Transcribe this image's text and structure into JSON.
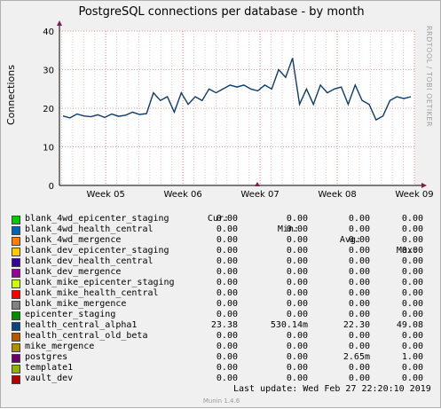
{
  "chart_data": {
    "type": "line",
    "title": "PostgreSQL connections per database - by month",
    "ylabel": "Connections",
    "ylim": [
      0,
      40
    ],
    "yticks": [
      0,
      10,
      20,
      30,
      40
    ],
    "xticks": [
      "Week 05",
      "Week 06",
      "Week 07",
      "Week 08",
      "Week 09"
    ],
    "grid": true,
    "series": [
      {
        "name": "health_central_alpha1",
        "color": "#0a3d6b",
        "x": [
          0,
          2,
          4,
          6,
          8,
          10,
          12,
          14,
          16,
          18,
          20,
          22,
          24,
          26,
          28,
          30,
          32,
          34,
          36,
          38,
          40,
          42,
          44,
          46,
          48,
          50,
          52,
          54,
          56,
          58,
          60,
          62,
          64,
          66,
          68,
          70,
          72,
          74,
          76,
          78,
          80,
          82,
          84,
          86,
          88,
          90,
          92,
          94,
          96,
          98,
          100
        ],
        "values": [
          18,
          17.5,
          18.5,
          18,
          17.8,
          18.3,
          17.6,
          18.5,
          17.9,
          18.2,
          19,
          18.4,
          18.6,
          24,
          22,
          23,
          19,
          24,
          21,
          23,
          22,
          25,
          24,
          25,
          26,
          25.5,
          26,
          25,
          24.5,
          26,
          25,
          30,
          28,
          33,
          21,
          25,
          21,
          26,
          24,
          25,
          25.5,
          21,
          26,
          22,
          21,
          17,
          18,
          22,
          23,
          22.5,
          23
        ]
      }
    ]
  },
  "ylabel_text": "Connections",
  "watermark": "RRDTOOL / TOBI OETIKER",
  "legend": {
    "headers": {
      "cur": "Cur:",
      "min": "Min:",
      "avg": "Avg:",
      "max": "Max:"
    },
    "rows": [
      {
        "name": "blank_4wd_epicenter_staging",
        "color": "#00cc00",
        "cur": "0.00",
        "min": "0.00",
        "avg": "0.00",
        "max": "0.00"
      },
      {
        "name": "blank_4wd_health_central",
        "color": "#0066b3",
        "cur": "0.00",
        "min": "0.00",
        "avg": "0.00",
        "max": "0.00"
      },
      {
        "name": "blank_4wd_mergence",
        "color": "#ff8000",
        "cur": "0.00",
        "min": "0.00",
        "avg": "0.00",
        "max": "0.00"
      },
      {
        "name": "blank_dev_epicenter_staging",
        "color": "#ffcc00",
        "cur": "0.00",
        "min": "0.00",
        "avg": "0.00",
        "max": "0.00"
      },
      {
        "name": "blank_dev_health_central",
        "color": "#330099",
        "cur": "0.00",
        "min": "0.00",
        "avg": "0.00",
        "max": "0.00"
      },
      {
        "name": "blank_dev_mergence",
        "color": "#990099",
        "cur": "0.00",
        "min": "0.00",
        "avg": "0.00",
        "max": "0.00"
      },
      {
        "name": "blank_mike_epicenter_staging",
        "color": "#ccff00",
        "cur": "0.00",
        "min": "0.00",
        "avg": "0.00",
        "max": "0.00"
      },
      {
        "name": "blank_mike_health_central",
        "color": "#ff0000",
        "cur": "0.00",
        "min": "0.00",
        "avg": "0.00",
        "max": "0.00"
      },
      {
        "name": "blank_mike_mergence",
        "color": "#808080",
        "cur": "0.00",
        "min": "0.00",
        "avg": "0.00",
        "max": "0.00"
      },
      {
        "name": "epicenter_staging",
        "color": "#008f00",
        "cur": "0.00",
        "min": "0.00",
        "avg": "0.00",
        "max": "0.00"
      },
      {
        "name": "health_central_alpha1",
        "color": "#00487d",
        "cur": "23.38",
        "min": "530.14m",
        "avg": "22.30",
        "max": "49.08"
      },
      {
        "name": "health_central_old_beta",
        "color": "#b35a00",
        "cur": "0.00",
        "min": "0.00",
        "avg": "0.00",
        "max": "0.00"
      },
      {
        "name": "mike_mergence",
        "color": "#b38f00",
        "cur": "0.00",
        "min": "0.00",
        "avg": "0.00",
        "max": "0.00"
      },
      {
        "name": "postgres",
        "color": "#6b006b",
        "cur": "0.00",
        "min": "0.00",
        "avg": "2.65m",
        "max": "1.00"
      },
      {
        "name": "template1",
        "color": "#8fb300",
        "cur": "0.00",
        "min": "0.00",
        "avg": "0.00",
        "max": "0.00"
      },
      {
        "name": "vault_dev",
        "color": "#b30000",
        "cur": "0.00",
        "min": "0.00",
        "avg": "0.00",
        "max": "0.00"
      }
    ]
  },
  "last_update": "Last update: Wed Feb 27 22:20:10 2019",
  "munin_version": "Munin 1.4.6"
}
